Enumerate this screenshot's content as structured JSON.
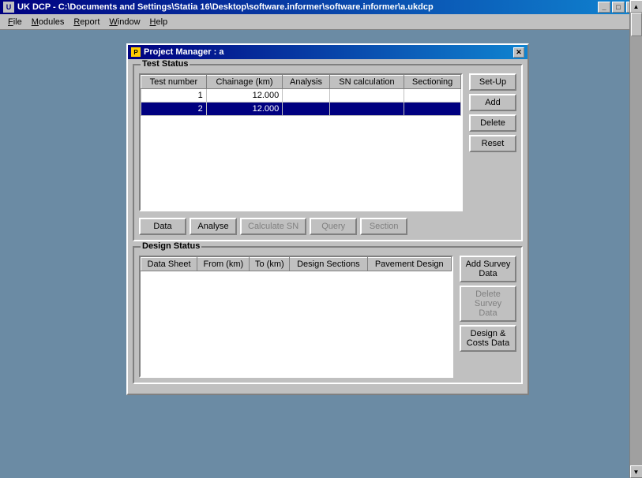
{
  "window": {
    "title": "UK DCP - C:\\Documents and Settings\\Statia 16\\Desktop\\software.informer\\software.informer\\a.ukdcp",
    "icon": "U"
  },
  "menubar": {
    "items": [
      "File",
      "Modules",
      "Report",
      "Window",
      "Help"
    ]
  },
  "dialog": {
    "title": "Project Manager : a",
    "test_status": {
      "label": "Test Status",
      "table": {
        "headers": [
          "Test number",
          "Chainage (km)",
          "Analysis",
          "SN calculation",
          "Sectioning"
        ],
        "rows": [
          {
            "test_number": "1",
            "chainage": "12.000",
            "analysis": "",
            "sn_calc": "",
            "sectioning": "",
            "selected": false
          },
          {
            "test_number": "2",
            "chainage": "12.000",
            "analysis": "",
            "sn_calc": "",
            "sectioning": "",
            "selected": true
          }
        ]
      },
      "buttons": {
        "setup": "Set-Up",
        "add": "Add",
        "delete": "Delete",
        "reset": "Reset"
      },
      "bottom_buttons": {
        "data": "Data",
        "analyse": "Analyse",
        "calculate_sn": "Calculate SN",
        "query": "Query",
        "section": "Section"
      }
    },
    "design_status": {
      "label": "Design Status",
      "table": {
        "headers": [
          "Data Sheet",
          "From (km)",
          "To (km)",
          "Design Sections",
          "Pavement Design"
        ],
        "rows": []
      },
      "buttons": {
        "add_survey_data": "Add Survey Data",
        "delete_survey_data": "Delete Survey Data",
        "design_costs_data": "Design & Costs Data"
      }
    }
  }
}
